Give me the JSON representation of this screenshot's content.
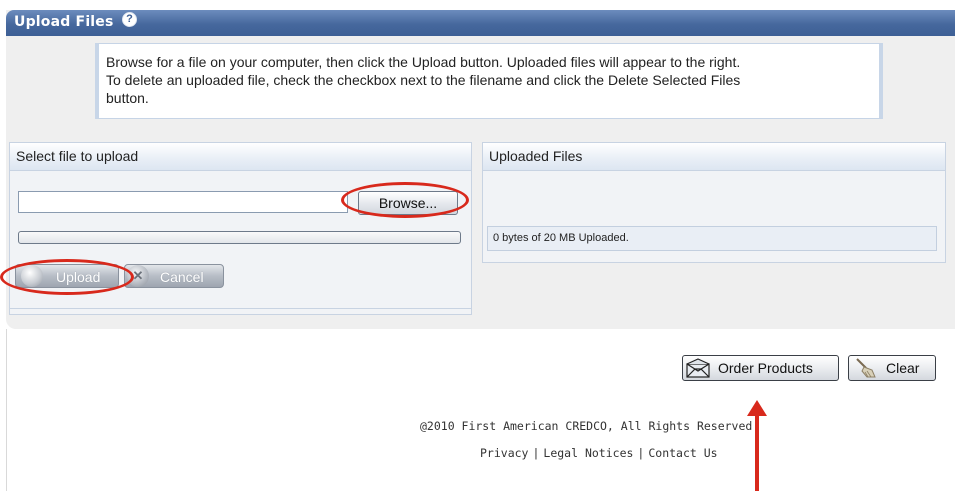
{
  "header": {
    "title": "Upload Files",
    "help_icon": "?"
  },
  "instructions": {
    "line1": "Browse for a file on your computer, then click the Upload button. Uploaded files will appear to the right.",
    "line2": "To delete an uploaded file, check the checkbox next to the filename and click the Delete Selected Files",
    "line3": "button."
  },
  "upload_panel": {
    "heading": "Select file to upload",
    "file_input_value": "",
    "browse_label": "Browse...",
    "progress_fraction": 0,
    "upload_label": "Upload",
    "cancel_label": "Cancel"
  },
  "uploaded_panel": {
    "heading": "Uploaded Files",
    "status": "0 bytes of 20 MB Uploaded."
  },
  "actions": {
    "order_label": "Order Products",
    "clear_label": "Clear"
  },
  "footer": {
    "copyright": "@2010 First American CREDCO, All Rights Reserved.",
    "links": [
      "Privacy",
      "Legal Notices",
      "Contact Us"
    ],
    "separator": "|"
  },
  "annotation_color": "#d8291c"
}
